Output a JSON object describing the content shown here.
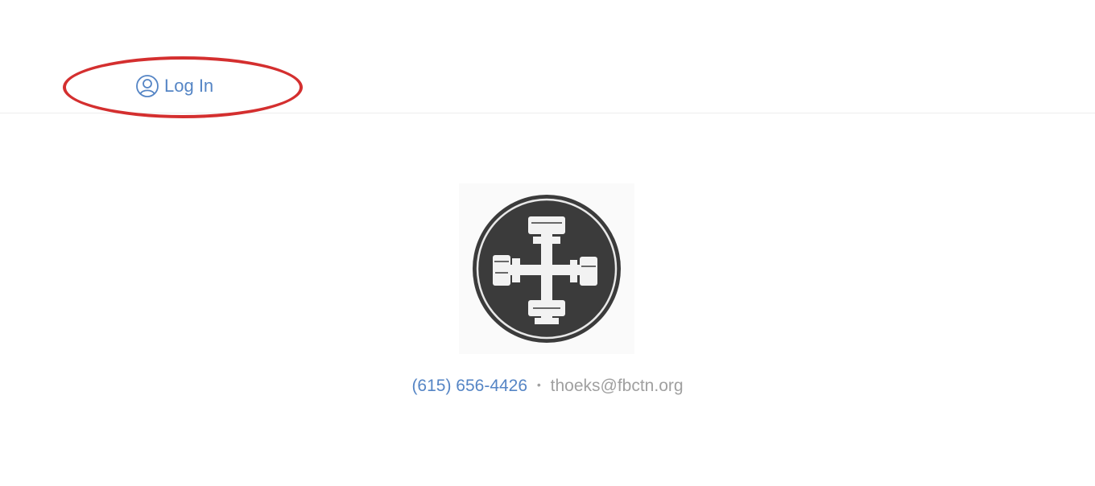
{
  "header": {
    "login_label": "Log In",
    "login_icon": "user-circle-icon",
    "accent_color": "#5585c5",
    "annotation_color": "#d42f2f"
  },
  "logo": {
    "icon": "barbell-cross-logo"
  },
  "contact": {
    "phone": "(615) 656-4426",
    "separator": "•",
    "email": "thoeks@fbctn.org"
  }
}
